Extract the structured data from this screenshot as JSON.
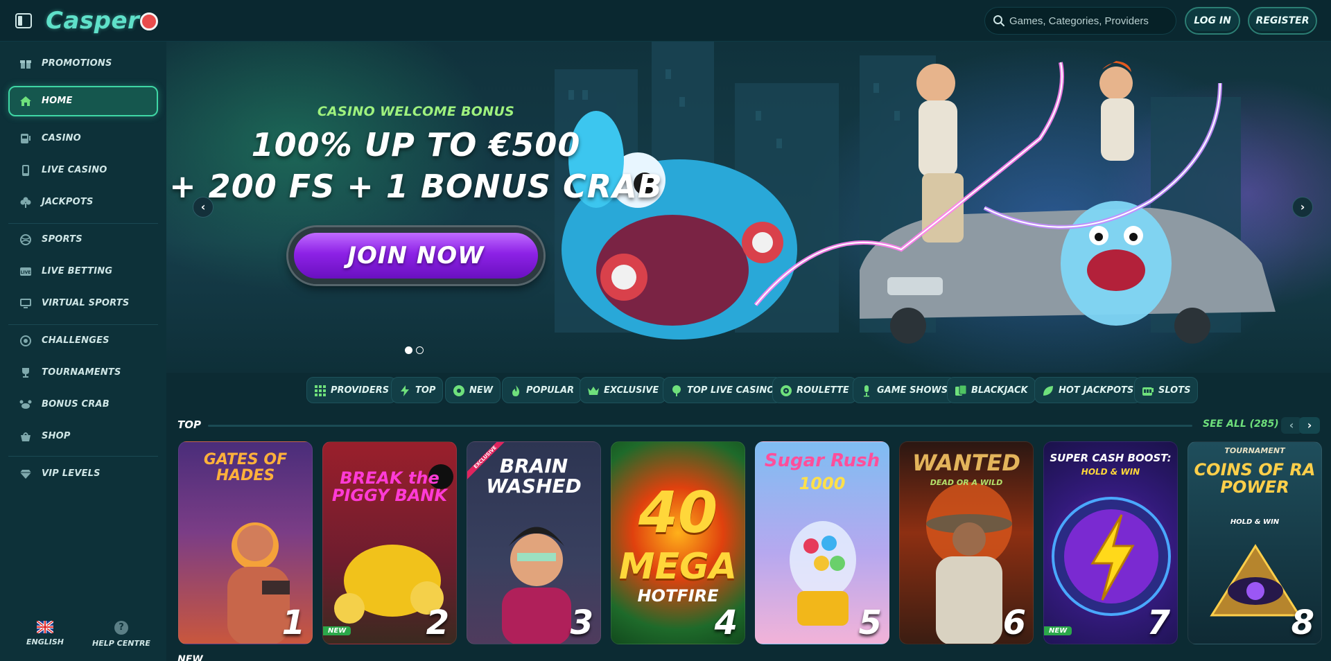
{
  "header": {
    "logo_text": "Casper",
    "search_placeholder": "Games, Categories, Providers",
    "login_label": "LOG IN",
    "register_label": "REGISTER"
  },
  "sidebar": {
    "items": [
      {
        "label": "PROMOTIONS",
        "icon": "gift-icon"
      },
      {
        "label": "HOME",
        "icon": "home-icon",
        "active": true
      },
      {
        "label": "CASINO",
        "icon": "casino-icon"
      },
      {
        "label": "LIVE CASINO",
        "icon": "mobile-icon"
      },
      {
        "label": "JACKPOTS",
        "icon": "clover-icon"
      },
      {
        "label": "SPORTS",
        "icon": "ball-icon"
      },
      {
        "label": "LIVE BETTING",
        "icon": "live-icon"
      },
      {
        "label": "VIRTUAL SPORTS",
        "icon": "monitor-icon"
      },
      {
        "label": "CHALLENGES",
        "icon": "target-icon"
      },
      {
        "label": "TOURNAMENTS",
        "icon": "trophy-icon"
      },
      {
        "label": "BONUS CRAB",
        "icon": "crab-icon"
      },
      {
        "label": "SHOP",
        "icon": "basket-icon"
      },
      {
        "label": "VIP LEVELS",
        "icon": "diamond-icon"
      }
    ],
    "language_label": "ENGLISH",
    "help_label": "HELP CENTRE"
  },
  "hero": {
    "subtitle": "CASINO WELCOME BONUS",
    "title_line1": "100% UP TO €500",
    "title_line2": "+ 200 FS + 1 BONUS CRAB",
    "cta_label": "JOIN NOW",
    "prev_glyph": "‹",
    "next_glyph": "›"
  },
  "filters": [
    {
      "label": "PROVIDERS",
      "icon": "grid-icon"
    },
    {
      "label": "TOP",
      "icon": "bolt-icon"
    },
    {
      "label": "NEW",
      "icon": "badge-icon"
    },
    {
      "label": "POPULAR",
      "icon": "flame-icon"
    },
    {
      "label": "EXCLUSIVE",
      "icon": "crown-icon"
    },
    {
      "label": "TOP LIVE CASINO",
      "icon": "pin-icon"
    },
    {
      "label": "ROULETTE",
      "icon": "roulette-icon"
    },
    {
      "label": "GAME SHOWS",
      "icon": "mic-icon"
    },
    {
      "label": "BLACKJACK",
      "icon": "cards-icon"
    },
    {
      "label": "HOT JACKPOTS",
      "icon": "leaf-icon"
    },
    {
      "label": "SLOTS",
      "icon": "slot-icon"
    }
  ],
  "top_section": {
    "title": "TOP",
    "see_all": "SEE ALL (285)",
    "prev_glyph": "‹",
    "next_glyph": "›"
  },
  "games": [
    {
      "title": "GATES OF HADES",
      "rank": "1"
    },
    {
      "title": "BREAK the PIGGY BANK",
      "rank": "2",
      "badge": "NEW"
    },
    {
      "title": "BRAIN WASHED",
      "rank": "3",
      "ribbon": "EXCLUSIVE"
    },
    {
      "title": "40",
      "subtitle": "MEGA",
      "subtitle2": "HOTFIRE",
      "rank": "4"
    },
    {
      "title": "Sugar Rush",
      "subtitle": "1000",
      "rank": "5"
    },
    {
      "title": "WANTED",
      "subtitle": "DEAD OR A WILD",
      "rank": "6"
    },
    {
      "title": "SUPER CASH BOOST:",
      "subtitle": "HOLD & WIN",
      "rank": "7",
      "badge": "NEW"
    },
    {
      "title": "COINS OF RA POWER",
      "subtitle": "HOLD & WIN",
      "top_label": "TOURNAMENT",
      "rank": "8"
    }
  ],
  "next_section_title": "NEW"
}
